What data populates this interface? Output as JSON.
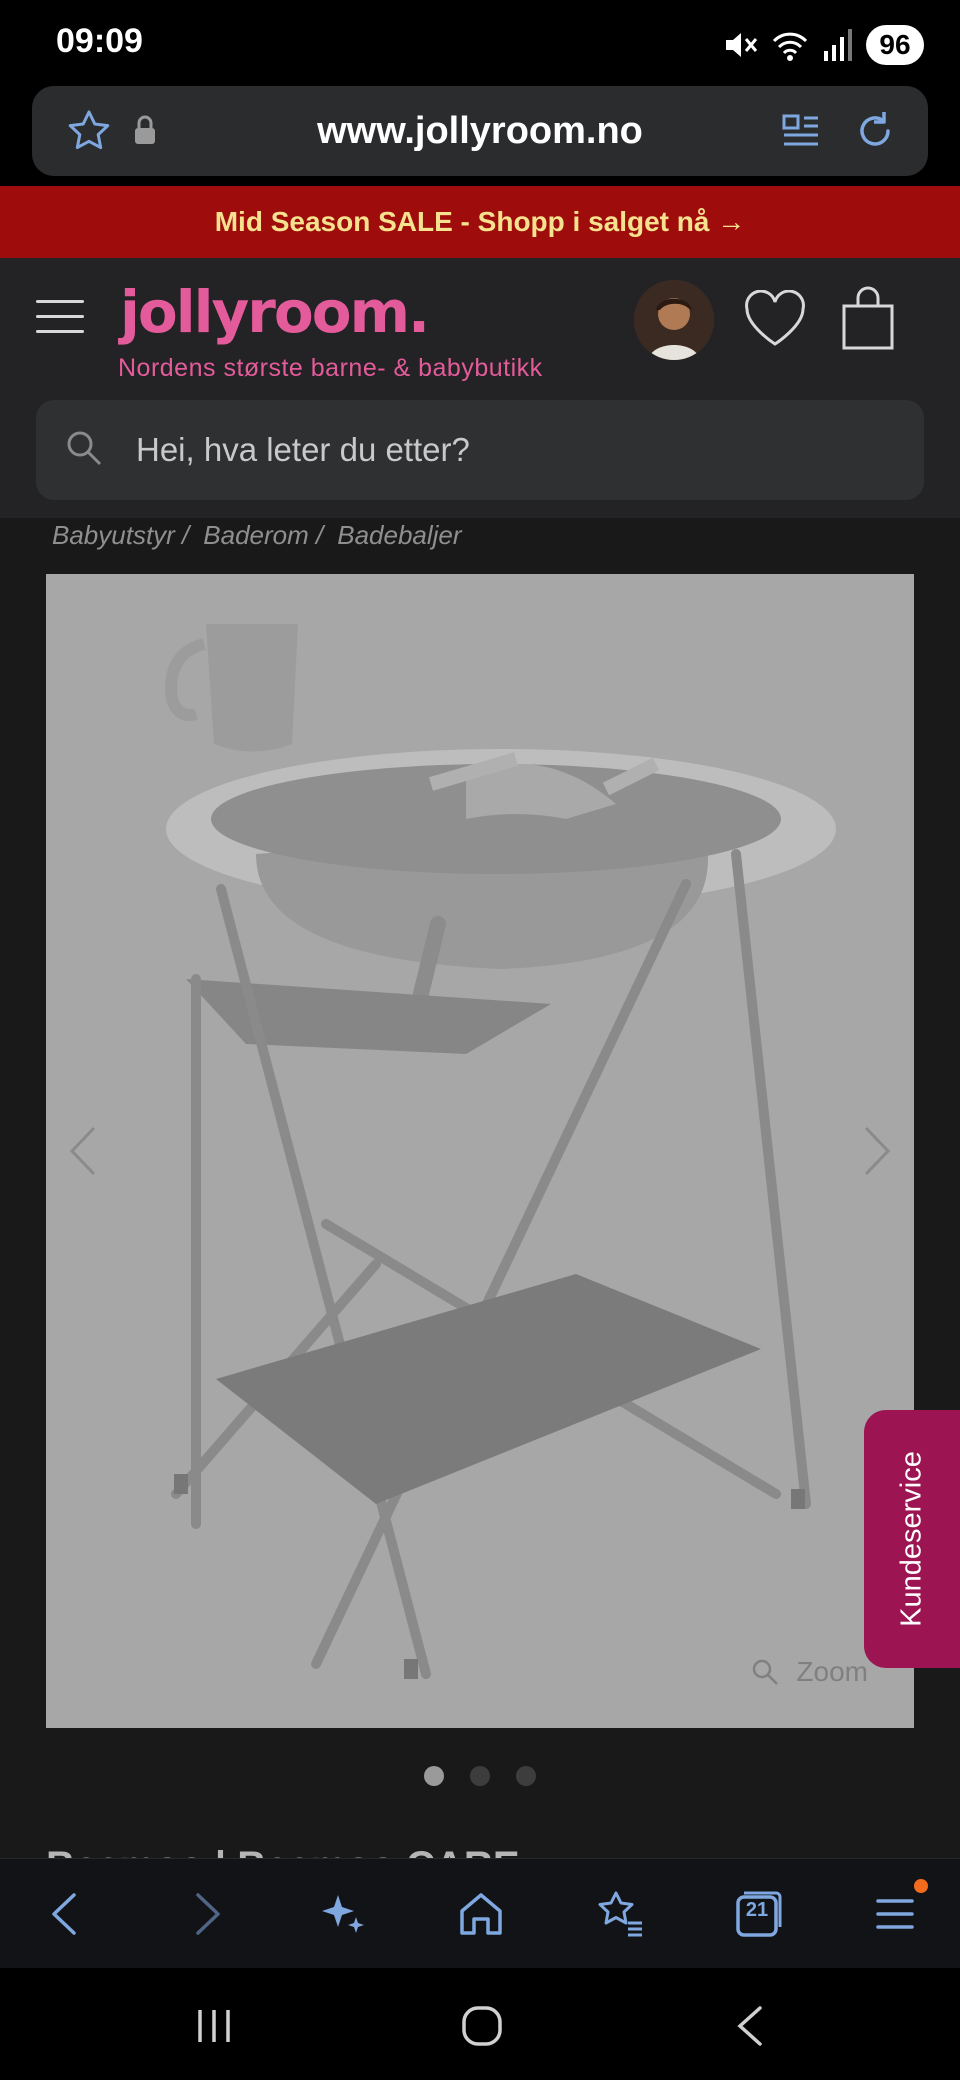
{
  "status_bar": {
    "time": "09:09",
    "battery": "96"
  },
  "browser": {
    "url": "www.jollyroom.no"
  },
  "promo": {
    "text": "Mid Season SALE - Shopp i salget nå →"
  },
  "header": {
    "logo": "jollyroom.",
    "tagline": "Nordens største barne- & babybutikk",
    "search_placeholder": "Hei, hva leter du etter?"
  },
  "breadcrumb": [
    "Babyutstyr /",
    "Baderom /",
    "Badebaljer"
  ],
  "gallery": {
    "zoom_label": "Zoom",
    "slide_count": 3,
    "active_slide": 1
  },
  "product": {
    "title_partial": "Beemoo | Beemoo CARE"
  },
  "side_tab": {
    "label": "Kundeservice"
  },
  "toolbar": {
    "tabs_count": "21"
  },
  "colors": {
    "accent_pink": "#e35b9a",
    "promo_red": "#9e0c0b",
    "promo_text": "#f6e18f",
    "kundeservice": "#9d1452"
  },
  "icons": [
    "star-icon",
    "lock-icon",
    "reader-icon",
    "reload-icon",
    "menu-icon",
    "avatar",
    "heart-icon",
    "bag-icon",
    "search-icon",
    "chevron-left-icon",
    "chevron-right-icon",
    "zoom-icon",
    "back-icon",
    "forward-icon",
    "sparkle-icon",
    "home-icon",
    "bookmarks-icon",
    "tabs-icon",
    "more-menu-icon"
  ]
}
